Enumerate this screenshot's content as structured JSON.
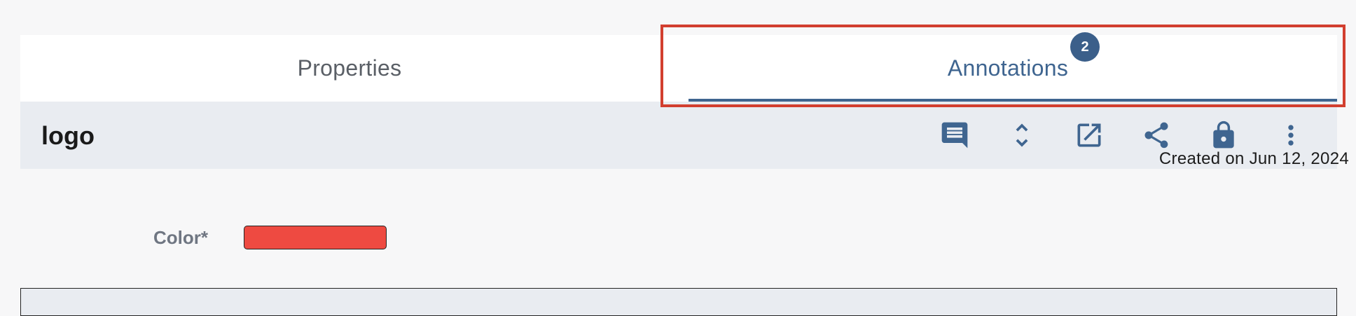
{
  "tabs": [
    {
      "label": "Properties",
      "active": false
    },
    {
      "label": "Annotations",
      "active": true,
      "badge": "2"
    }
  ],
  "header": {
    "title": "logo",
    "actions": [
      "comment-icon",
      "expand-collapse-icon",
      "open-external-icon",
      "share-icon",
      "lock-icon",
      "more-vert-icon"
    ]
  },
  "meta": {
    "created": "Created on Jun 12, 2024"
  },
  "fields": {
    "color_label": "Color*",
    "color_value": "#ee4a41"
  },
  "colors": {
    "accent": "#3f6590",
    "highlight": "#d23f2f",
    "header_bg": "#e9ecf1"
  }
}
